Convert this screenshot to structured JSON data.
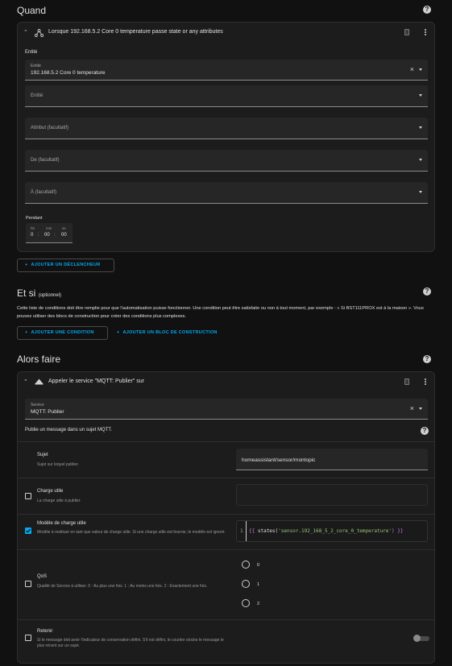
{
  "quand": {
    "title": "Quand",
    "trigger_header": "Lorsque 192.168.5.2 Core 0 temperature passe state or any attributes",
    "entity_section_label": "Entité",
    "entity_field": {
      "label": "Entité",
      "value": "192.168.5.2 Core 0 temperature"
    },
    "entity_field2": {
      "label": "Entité"
    },
    "attribute_field": {
      "label": "Attribut (facultatif)"
    },
    "from_field": {
      "label": "De (facultatif)"
    },
    "to_field": {
      "label": "À (facultatif)"
    },
    "duration": {
      "label": "Pendant",
      "hh_label": "hh",
      "mm_label": "min",
      "ss_label": "ss",
      "hh": "0",
      "mm": "00",
      "ss": "00",
      "sep": ":"
    },
    "add_trigger_label": "AJOUTER UN DÉCLENCHEUR"
  },
  "etsi": {
    "title": "Et si",
    "optional": "(optionnel)",
    "description": "Cette liste de conditions doit être remplie pour que l'automatisation puisse fonctionner. Une condition peut être satisfaite ou non à tout moment, par exemple : « Si BST111PROX est à la maison ». Vous pouvez utiliser des blocs de construction pour créer des conditions plus complexes.",
    "add_condition_label": "AJOUTER UNE CONDITION",
    "add_block_label": "AJOUTER UN BLOC DE CONSTRUCTION"
  },
  "alors": {
    "title": "Alors faire",
    "action_header": "Appeler le service \"MQTT: Publier\" sur",
    "service_field": {
      "label": "Service",
      "value": "MQTT: Publier"
    },
    "service_desc": "Publie un message dans un sujet MQTT.",
    "sujet": {
      "title": "Sujet",
      "desc": "Sujet sur lequel publier.",
      "value": "homeassistant/sensor/montopic"
    },
    "charge": {
      "title": "Charge utile",
      "desc": "La charge utile à publier."
    },
    "modele": {
      "title": "Modèle de charge utile",
      "desc": "Modèle à restituer en tant que valeur de charge utile. Si une charge utile est fournie, le modèle est ignoré.",
      "line_no": "1",
      "code_open": "{{",
      "code_fn": "states(",
      "code_str": "'sensor.192_168_5_2_core_0_temperature'",
      "code_close": ") }}"
    },
    "qos": {
      "title": "QoS",
      "desc": "Qualité de Service à utiliser. 0 : Au plus une fois. 1 : Au moins une fois. 2 : Exactement une fois.",
      "options": [
        "0",
        "1",
        "2"
      ]
    },
    "retenir": {
      "title": "Retenir",
      "desc": "Si le message doit avoir l'indicateur de conservation défini. S'il est défini, le courtier stocke le message le plus récent sur un sujet."
    }
  },
  "colors": {
    "accent": "#03a9f4",
    "background": "#111111",
    "card": "#1c1c1c"
  }
}
